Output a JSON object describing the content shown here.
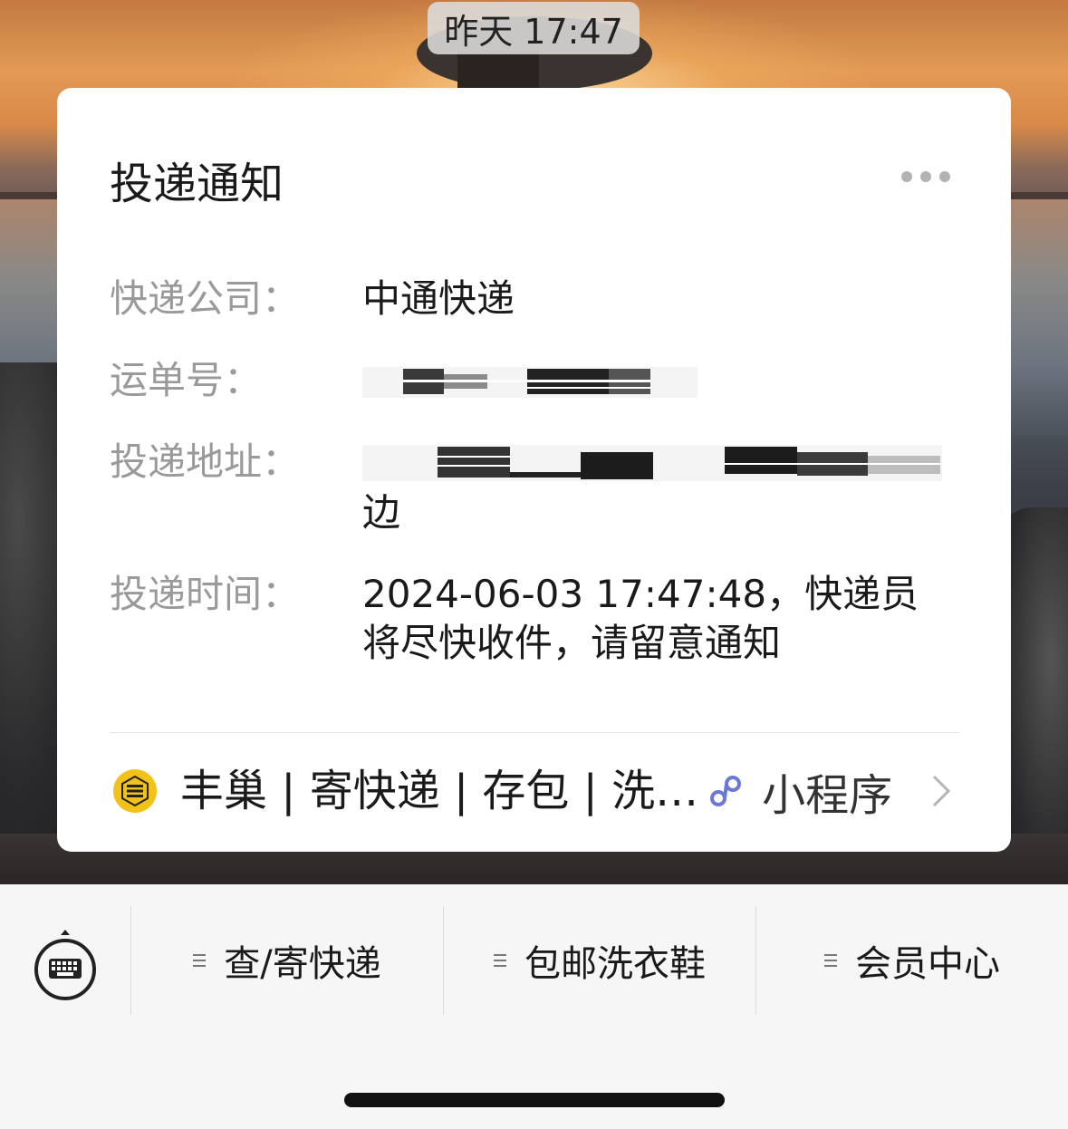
{
  "timestamp": "昨天 17:47",
  "card": {
    "title": "投递通知",
    "more_icon": "more-dots-icon",
    "rows": [
      {
        "label": "快递公司：",
        "value": "中通快递"
      },
      {
        "label": "运单号：",
        "value": ""
      },
      {
        "label": "投递地址：",
        "value_tail": "边"
      },
      {
        "label": "投递时间：",
        "value": "2024-06-03 17:47:48，快递员将尽快收件，请留意通知"
      }
    ]
  },
  "mini_program": {
    "logo_icon": "fengchao-logo-icon",
    "links_text": "丰巢 | 寄快递 | 存包 | 洗…",
    "type_icon": "mini-program-link-icon",
    "type_label": "小程序",
    "chevron_icon": "chevron-right-icon"
  },
  "bottom_menu": {
    "keyboard_icon": "keyboard-toggle-icon",
    "items": [
      {
        "label": "查/寄快递"
      },
      {
        "label": "包邮洗衣鞋"
      },
      {
        "label": "会员中心"
      }
    ]
  },
  "colors": {
    "brand_yellow": "#f2c21a",
    "mini_program_blue": "#6b78d6"
  }
}
